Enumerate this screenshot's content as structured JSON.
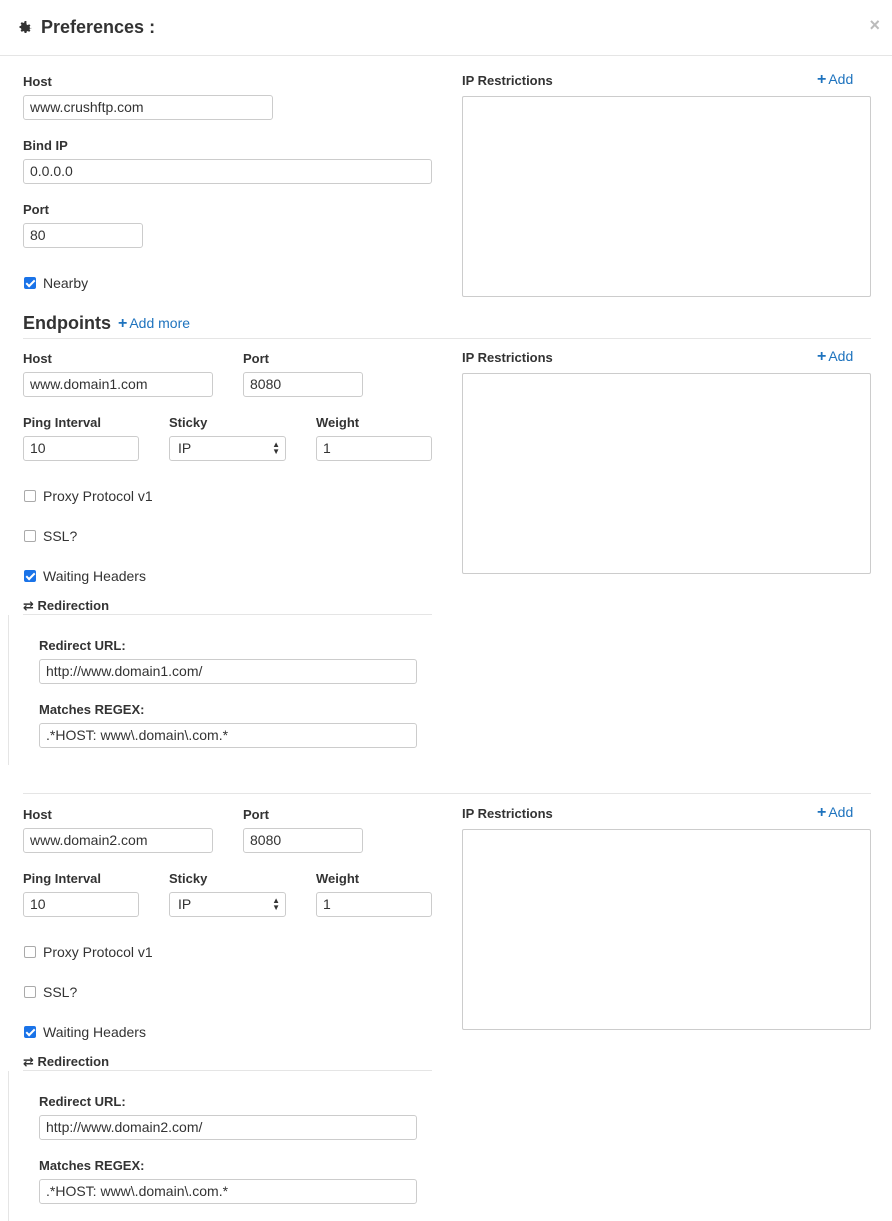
{
  "dialog": {
    "title": "Preferences :",
    "close": "×"
  },
  "main": {
    "host_label": "Host",
    "host_value": "www.crushftp.com",
    "bind_ip_label": "Bind IP",
    "bind_ip_value": "0.0.0.0",
    "port_label": "Port",
    "port_value": "80",
    "nearby_label": "Nearby",
    "nearby_checked": true,
    "ip_restrictions_label": "IP Restrictions",
    "add_label": "Add"
  },
  "endpoints": {
    "title": "Endpoints",
    "add_more_label": "Add more",
    "items": [
      {
        "host_label": "Host",
        "host_value": "www.domain1.com",
        "port_label": "Port",
        "port_value": "8080",
        "ping_label": "Ping Interval",
        "ping_value": "10",
        "sticky_label": "Sticky",
        "sticky_value": "IP",
        "weight_label": "Weight",
        "weight_value": "1",
        "proxy_label": "Proxy Protocol v1",
        "proxy_checked": false,
        "ssl_label": "SSL?",
        "ssl_checked": false,
        "waiting_label": "Waiting Headers",
        "waiting_checked": true,
        "redirection_label": "Redirection",
        "redirect_url_label": "Redirect URL:",
        "redirect_url_value": "http://www.domain1.com/",
        "regex_label": "Matches REGEX:",
        "regex_value": ".*HOST: www\\.domain\\.com.*",
        "ip_restrictions_label": "IP Restrictions",
        "add_label": "Add"
      },
      {
        "host_label": "Host",
        "host_value": "www.domain2.com",
        "port_label": "Port",
        "port_value": "8080",
        "ping_label": "Ping Interval",
        "ping_value": "10",
        "sticky_label": "Sticky",
        "sticky_value": "IP",
        "weight_label": "Weight",
        "weight_value": "1",
        "proxy_label": "Proxy Protocol v1",
        "proxy_checked": false,
        "ssl_label": "SSL?",
        "ssl_checked": false,
        "waiting_label": "Waiting Headers",
        "waiting_checked": true,
        "redirection_label": "Redirection",
        "redirect_url_label": "Redirect URL:",
        "redirect_url_value": "http://www.domain2.com/",
        "regex_label": "Matches REGEX:",
        "regex_value": ".*HOST: www\\.domain\\.com.*",
        "ip_restrictions_label": "IP Restrictions",
        "add_label": "Add"
      }
    ]
  },
  "icons": {
    "gear": "gear-icon",
    "plus": "plus-icon",
    "exchange": "exchange-icon"
  },
  "colors": {
    "link": "#1e73be",
    "checkbox": "#1a73e8"
  }
}
